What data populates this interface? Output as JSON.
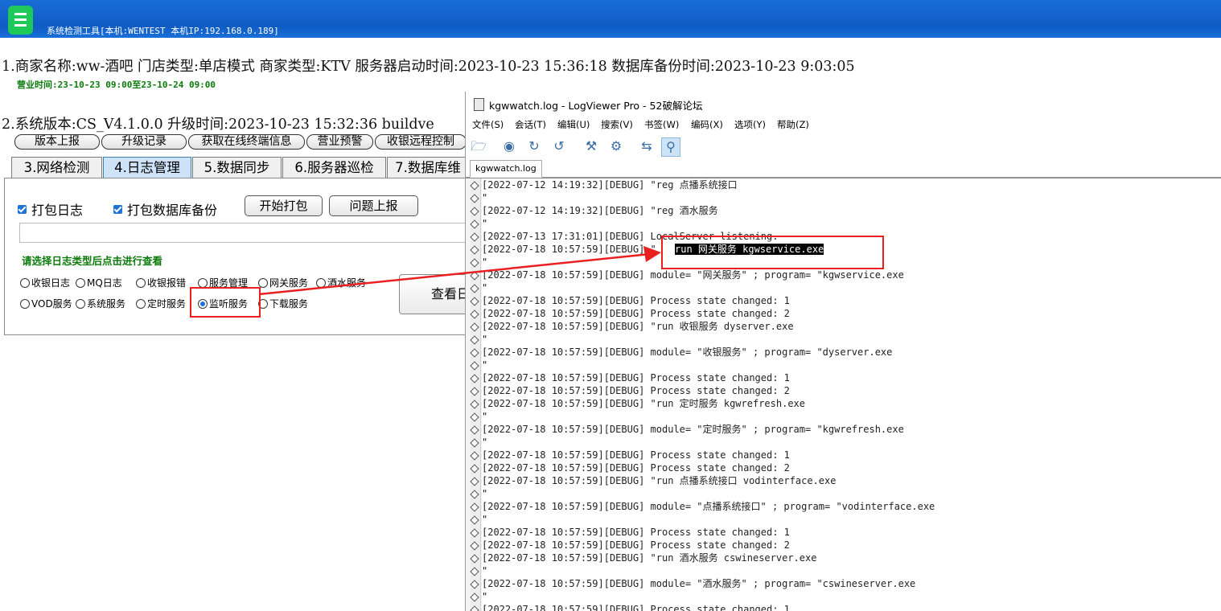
{
  "window": {
    "title": "系统检测工具[本机:WENTEST 本机IP:192.168.0.189]"
  },
  "info": {
    "line1": "1.商家名称:ww-酒吧  门店类型:单店模式  商家类型:KTV  服务器启动时间:2023-10-23 15:36:18  数据库备份时间:2023-10-23 9:03:05",
    "business_hours": "营业时间:23-10-23 09:00至23-10-24 09:00",
    "line2": "2.系统版本:CS_V4.1.0.0 升级时间:2023-10-23 15:32:36 buildve"
  },
  "toolbar_buttons": [
    "版本上报",
    "升级记录",
    "获取在线终端信息",
    "营业预警",
    "收银远程控制"
  ],
  "tabs": [
    "3.网络检测",
    "4.日志管理",
    "5.数据同步",
    "6.服务器巡检",
    "7.数据库维"
  ],
  "active_tab": "4.日志管理",
  "panel": {
    "check_pack_log": "打包日志",
    "check_pack_db": "打包数据库备份",
    "start_pack": "开始打包",
    "report_issue": "问题上报",
    "path_value": "",
    "prompt": "请选择日志类型后点击进行查看",
    "view_log": "查看日志",
    "radios_row1": [
      "收银日志",
      "MQ日志",
      "收银报错",
      "服务管理",
      "网关服务",
      "酒水服务"
    ],
    "radios_row2": [
      "VOD服务",
      "系统服务",
      "定时服务",
      "监听服务",
      "下载服务"
    ],
    "selected_radio": "监听服务"
  },
  "logviewer": {
    "title": "kgwwatch.log - LogViewer Pro - 52破解论坛",
    "menu": [
      "文件(S)",
      "会话(T)",
      "编辑(U)",
      "搜索(V)",
      "书签(W)",
      "编码(X)",
      "选项(Y)",
      "帮助(Z)"
    ],
    "file_tab": "kgwwatch.log",
    "lines": [
      "[2022-07-12 14:19:32][DEBUG] \"reg 点播系统接口",
      "\"",
      "[2022-07-12 14:19:32][DEBUG] \"reg 酒水服务",
      "\"",
      "[2022-07-13 17:31:01][DEBUG] LocalServer listening.",
      "[2022-07-18 10:57:59][DEBUG] \"",
      "\"",
      "[2022-07-18 10:57:59][DEBUG] module= \"网关服务\" ; program= \"kgwservice.exe",
      "\"",
      "[2022-07-18 10:57:59][DEBUG] Process state changed: 1",
      "[2022-07-18 10:57:59][DEBUG] Process state changed: 2",
      "[2022-07-18 10:57:59][DEBUG] \"run 收银服务 dyserver.exe",
      "\"",
      "[2022-07-18 10:57:59][DEBUG] module= \"收银服务\" ; program= \"dyserver.exe",
      "\"",
      "[2022-07-18 10:57:59][DEBUG] Process state changed: 1",
      "[2022-07-18 10:57:59][DEBUG] Process state changed: 2",
      "[2022-07-18 10:57:59][DEBUG] \"run 定时服务 kgwrefresh.exe",
      "\"",
      "[2022-07-18 10:57:59][DEBUG] module= \"定时服务\" ; program= \"kgwrefresh.exe",
      "\"",
      "[2022-07-18 10:57:59][DEBUG] Process state changed: 1",
      "[2022-07-18 10:57:59][DEBUG] Process state changed: 2",
      "[2022-07-18 10:57:59][DEBUG] \"run 点播系统接口 vodinterface.exe",
      "\"",
      "[2022-07-18 10:57:59][DEBUG] module= \"点播系统接口\" ; program= \"vodinterface.exe",
      "\"",
      "[2022-07-18 10:57:59][DEBUG] Process state changed: 1",
      "[2022-07-18 10:57:59][DEBUG] Process state changed: 2",
      "[2022-07-18 10:57:59][DEBUG] \"run 酒水服务 cswineserver.exe",
      "\"",
      "[2022-07-18 10:57:59][DEBUG] module= \"酒水服务\" ; program= \"cswineserver.exe",
      "\"",
      "[2022-07-18 10:57:59][DEBUG] Process state changed: 1"
    ],
    "selected_text": "run 网关服务 kgwservice.exe"
  }
}
